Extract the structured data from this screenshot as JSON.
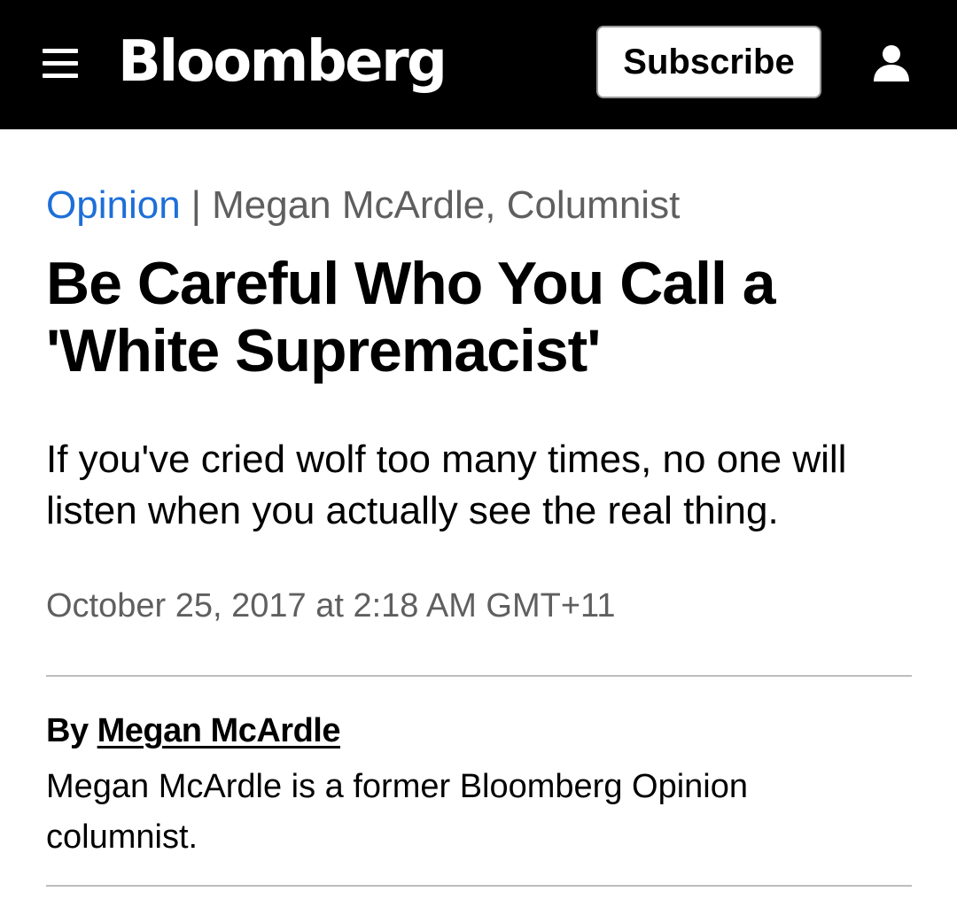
{
  "header": {
    "logo_text": "Bloomberg",
    "subscribe_label": "Subscribe",
    "menu_icon": "hamburger-menu-icon",
    "account_icon": "user-account-icon",
    "background_color": "#000000"
  },
  "article": {
    "section": "Opinion",
    "separator": "|",
    "author_line": "Megan McArdle, Columnist",
    "headline": "Be Careful Who You Call a 'White Supremacist'",
    "dek": "If you've cried wolf too many times, no one will listen when you actually see the real thing.",
    "timestamp": "October 25, 2017 at 2:18 AM GMT+11",
    "byline_prefix": "By",
    "byline_author": "Megan McArdle",
    "author_bio": "Megan McArdle is a former Bloomberg Opinion columnist."
  },
  "colors": {
    "section_link": "#1d6fd8",
    "meta_gray": "#5f5f5f",
    "rule_gray": "#bdbdbd"
  }
}
